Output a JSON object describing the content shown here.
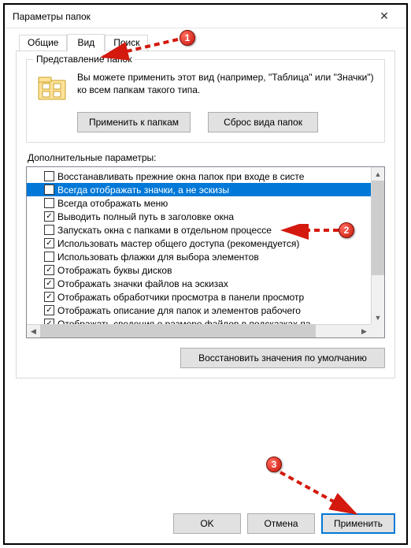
{
  "window": {
    "title": "Параметры папок"
  },
  "tabs": {
    "general": "Общие",
    "view": "Вид",
    "search": "Поиск"
  },
  "folder_views": {
    "group_title": "Представление папок",
    "description": "Вы можете применить этот вид (например, \"Таблица\" или \"Значки\") ко всем папкам такого типа.",
    "apply_btn": "Применить к папкам",
    "reset_btn": "Сброс вида папок"
  },
  "advanced": {
    "label": "Дополнительные параметры:",
    "items": [
      {
        "checked": false,
        "label": "Восстанавливать прежние окна папок при входе в систе"
      },
      {
        "checked": false,
        "label": "Всегда отображать значки, а не эскизы",
        "selected": true
      },
      {
        "checked": false,
        "label": "Всегда отображать меню"
      },
      {
        "checked": true,
        "label": "Выводить полный путь в заголовке окна"
      },
      {
        "checked": false,
        "label": "Запускать окна с папками в отдельном процессе"
      },
      {
        "checked": true,
        "label": "Использовать мастер общего доступа (рекомендуется)"
      },
      {
        "checked": false,
        "label": "Использовать флажки для выбора элементов"
      },
      {
        "checked": true,
        "label": "Отображать буквы дисков"
      },
      {
        "checked": true,
        "label": "Отображать значки файлов на эскизах"
      },
      {
        "checked": true,
        "label": "Отображать обработчики просмотра в панели просмотр"
      },
      {
        "checked": true,
        "label": "Отображать описание для папок и элементов рабочего"
      },
      {
        "checked": true,
        "label": "Отображать сведения о размере файлов в подсказках па"
      }
    ],
    "restore_btn": "Восстановить значения по умолчанию"
  },
  "buttons": {
    "ok": "OK",
    "cancel": "Отмена",
    "apply": "Применить"
  },
  "annotations": {
    "b1": "1",
    "b2": "2",
    "b3": "3"
  }
}
